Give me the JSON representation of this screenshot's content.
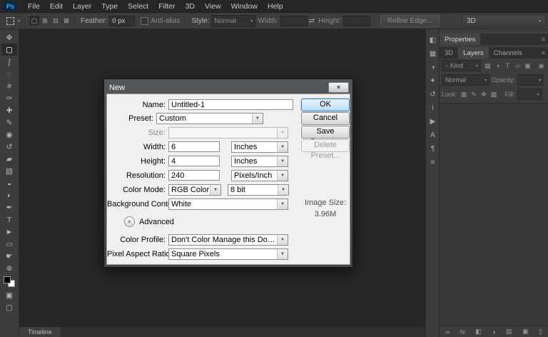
{
  "colors": {
    "ps_logo_blue": "#31a8ff",
    "menubar_bg": "#262626",
    "panel_bg": "#3d3d3d",
    "canvas_bg": "#272727",
    "dialog_body": "#f0f0f0",
    "ok_button_border": "#3c7fb1"
  },
  "icons": {
    "dropdown_arrow": "▼",
    "small_arrow": "▾",
    "swap": "⇄",
    "close": "×",
    "advanced_toggle": "«",
    "panel_menu": "≡",
    "filter_toggle": "◉",
    "search": "○"
  },
  "menubar": {
    "logo": "Ps",
    "items": [
      {
        "name": "menu-file",
        "label": "File"
      },
      {
        "name": "menu-edit",
        "label": "Edit"
      },
      {
        "name": "menu-layer",
        "label": "Layer"
      },
      {
        "name": "menu-type",
        "label": "Type"
      },
      {
        "name": "menu-select",
        "label": "Select"
      },
      {
        "name": "menu-filter",
        "label": "Filter"
      },
      {
        "name": "menu-3d",
        "label": "3D"
      },
      {
        "name": "menu-view",
        "label": "View"
      },
      {
        "name": "menu-window",
        "label": "Window"
      },
      {
        "name": "menu-help",
        "label": "Help"
      }
    ]
  },
  "options_bar": {
    "selection_modes": [
      {
        "name": "new-selection-icon",
        "glyph": "▢",
        "active": "true"
      },
      {
        "name": "add-to-selection-icon",
        "glyph": "⊞"
      },
      {
        "name": "subtract-from-selection-icon",
        "glyph": "⊟"
      },
      {
        "name": "intersect-selection-icon",
        "glyph": "⊠"
      }
    ],
    "feather_label": "Feather:",
    "feather_value": "0 px",
    "antialias_label": "Anti-alias",
    "style_label": "Style:",
    "style_value": "Normal",
    "width_label": "Width:",
    "width_value": "",
    "height_label": "Height:",
    "height_value": "",
    "refine_edge_label": "Refine Edge...",
    "workspace_label": "3D"
  },
  "toolbar": {
    "tools": [
      {
        "name": "move-tool-icon",
        "glyph": "✥"
      },
      {
        "name": "rectangular-marquee-tool-icon",
        "glyph": "▢",
        "active": "true"
      },
      {
        "name": "lasso-tool-icon",
        "glyph": "ʃ"
      },
      {
        "name": "quick-selection-tool-icon",
        "glyph": "◌"
      },
      {
        "name": "crop-tool-icon",
        "glyph": "#"
      },
      {
        "name": "eyedropper-tool-icon",
        "glyph": "✑"
      },
      {
        "name": "healing-brush-tool-icon",
        "glyph": "✚"
      },
      {
        "name": "brush-tool-icon",
        "glyph": "✎"
      },
      {
        "name": "clone-stamp-tool-icon",
        "glyph": "◉"
      },
      {
        "name": "history-brush-tool-icon",
        "glyph": "↺"
      },
      {
        "name": "eraser-tool-icon",
        "glyph": "▰"
      },
      {
        "name": "gradient-tool-icon",
        "glyph": "▨"
      },
      {
        "name": "blur-tool-icon",
        "glyph": "◒"
      },
      {
        "name": "dodge-tool-icon",
        "glyph": "◐"
      },
      {
        "name": "pen-tool-icon",
        "glyph": "✒"
      },
      {
        "name": "type-tool-icon",
        "glyph": "T"
      },
      {
        "name": "path-selection-tool-icon",
        "glyph": "►"
      },
      {
        "name": "rectangle-tool-icon",
        "glyph": "▭"
      },
      {
        "name": "hand-tool-icon",
        "glyph": "☛"
      },
      {
        "name": "zoom-tool-icon",
        "glyph": "⊕"
      }
    ],
    "bottom_tools": [
      {
        "name": "quick-mask-icon",
        "glyph": "▣"
      },
      {
        "name": "screen-mode-icon",
        "glyph": "▢"
      }
    ]
  },
  "dock_icons": [
    {
      "name": "color-panel-icon",
      "glyph": "◧"
    },
    {
      "name": "swatches-panel-icon",
      "glyph": "▦"
    },
    {
      "name": "adjustments-panel-icon",
      "glyph": "◑"
    },
    {
      "name": "styles-panel-icon",
      "glyph": "✦"
    },
    {
      "name": "history-panel-icon",
      "glyph": "↺"
    },
    {
      "name": "info-panel-icon",
      "glyph": "i"
    },
    {
      "name": "actions-panel-icon",
      "glyph": "▶"
    },
    {
      "name": "character-panel-icon",
      "glyph": "A"
    },
    {
      "name": "paragraph-panel-icon",
      "glyph": "¶"
    },
    {
      "name": "layer-comps-panel-icon",
      "glyph": "≡"
    }
  ],
  "panels": {
    "properties_tab": "Properties",
    "layers_tabs": [
      {
        "name": "tab-3d",
        "label": "3D"
      },
      {
        "name": "tab-layers",
        "label": "Layers",
        "active": "true"
      },
      {
        "name": "tab-channels",
        "label": "Channels"
      }
    ],
    "kind_label": "Kind",
    "filter_icons": [
      {
        "name": "filter-pixel-layers-icon",
        "glyph": "▦"
      },
      {
        "name": "filter-adjustment-layers-icon",
        "glyph": "◑"
      },
      {
        "name": "filter-type-layers-icon",
        "glyph": "T"
      },
      {
        "name": "filter-shape-layers-icon",
        "glyph": "▱"
      },
      {
        "name": "filter-smart-objects-icon",
        "glyph": "▣"
      }
    ],
    "blend_mode_value": "Normal",
    "opacity_label": "Opacity:",
    "opacity_value": "",
    "lock_label": "Lock:",
    "lock_icons": [
      {
        "name": "lock-transparent-pixels-icon",
        "glyph": "▦"
      },
      {
        "name": "lock-image-pixels-icon",
        "glyph": "✎"
      },
      {
        "name": "lock-position-icon",
        "glyph": "✥"
      },
      {
        "name": "lock-all-icon",
        "glyph": "▩"
      }
    ],
    "fill_label": "Fill:",
    "fill_value": "",
    "bottom_icons": [
      {
        "name": "link-layers-icon",
        "glyph": "∞"
      },
      {
        "name": "layer-style-icon",
        "glyph": "fx"
      },
      {
        "name": "layer-mask-icon",
        "glyph": "◧"
      },
      {
        "name": "adjustment-layer-icon",
        "glyph": "◑"
      },
      {
        "name": "new-group-icon",
        "glyph": "▤"
      },
      {
        "name": "new-layer-icon",
        "glyph": "▣"
      },
      {
        "name": "delete-layer-icon",
        "glyph": "▯"
      }
    ]
  },
  "canvas": {
    "timeline_tab": "Timeline"
  },
  "dialog": {
    "title": "New",
    "name_label": "Name:",
    "name_value": "Untitled-1",
    "preset_label": "Preset:",
    "preset_value": "Custom",
    "size_label": "Size:",
    "size_value": "",
    "width_label": "Width:",
    "width_value": "6",
    "width_unit": "Inches",
    "height_label": "Height:",
    "height_value": "4",
    "height_unit": "Inches",
    "resolution_label": "Resolution:",
    "resolution_value": "240",
    "resolution_unit": "Pixels/Inch",
    "color_mode_label": "Color Mode:",
    "color_mode_value": "RGB Color",
    "bit_depth_value": "8 bit",
    "background_label": "Background Contents:",
    "background_value": "White",
    "advanced_label": "Advanced",
    "color_profile_label": "Color Profile:",
    "color_profile_value": "Don't Color Manage this Document",
    "pixel_aspect_label": "Pixel Aspect Ratio:",
    "pixel_aspect_value": "Square Pixels",
    "ok_label": "OK",
    "cancel_label": "Cancel",
    "save_preset_label": "Save Preset...",
    "delete_preset_label": "Delete Preset...",
    "image_size_label": "Image Size:",
    "image_size_value": "3.96M"
  }
}
